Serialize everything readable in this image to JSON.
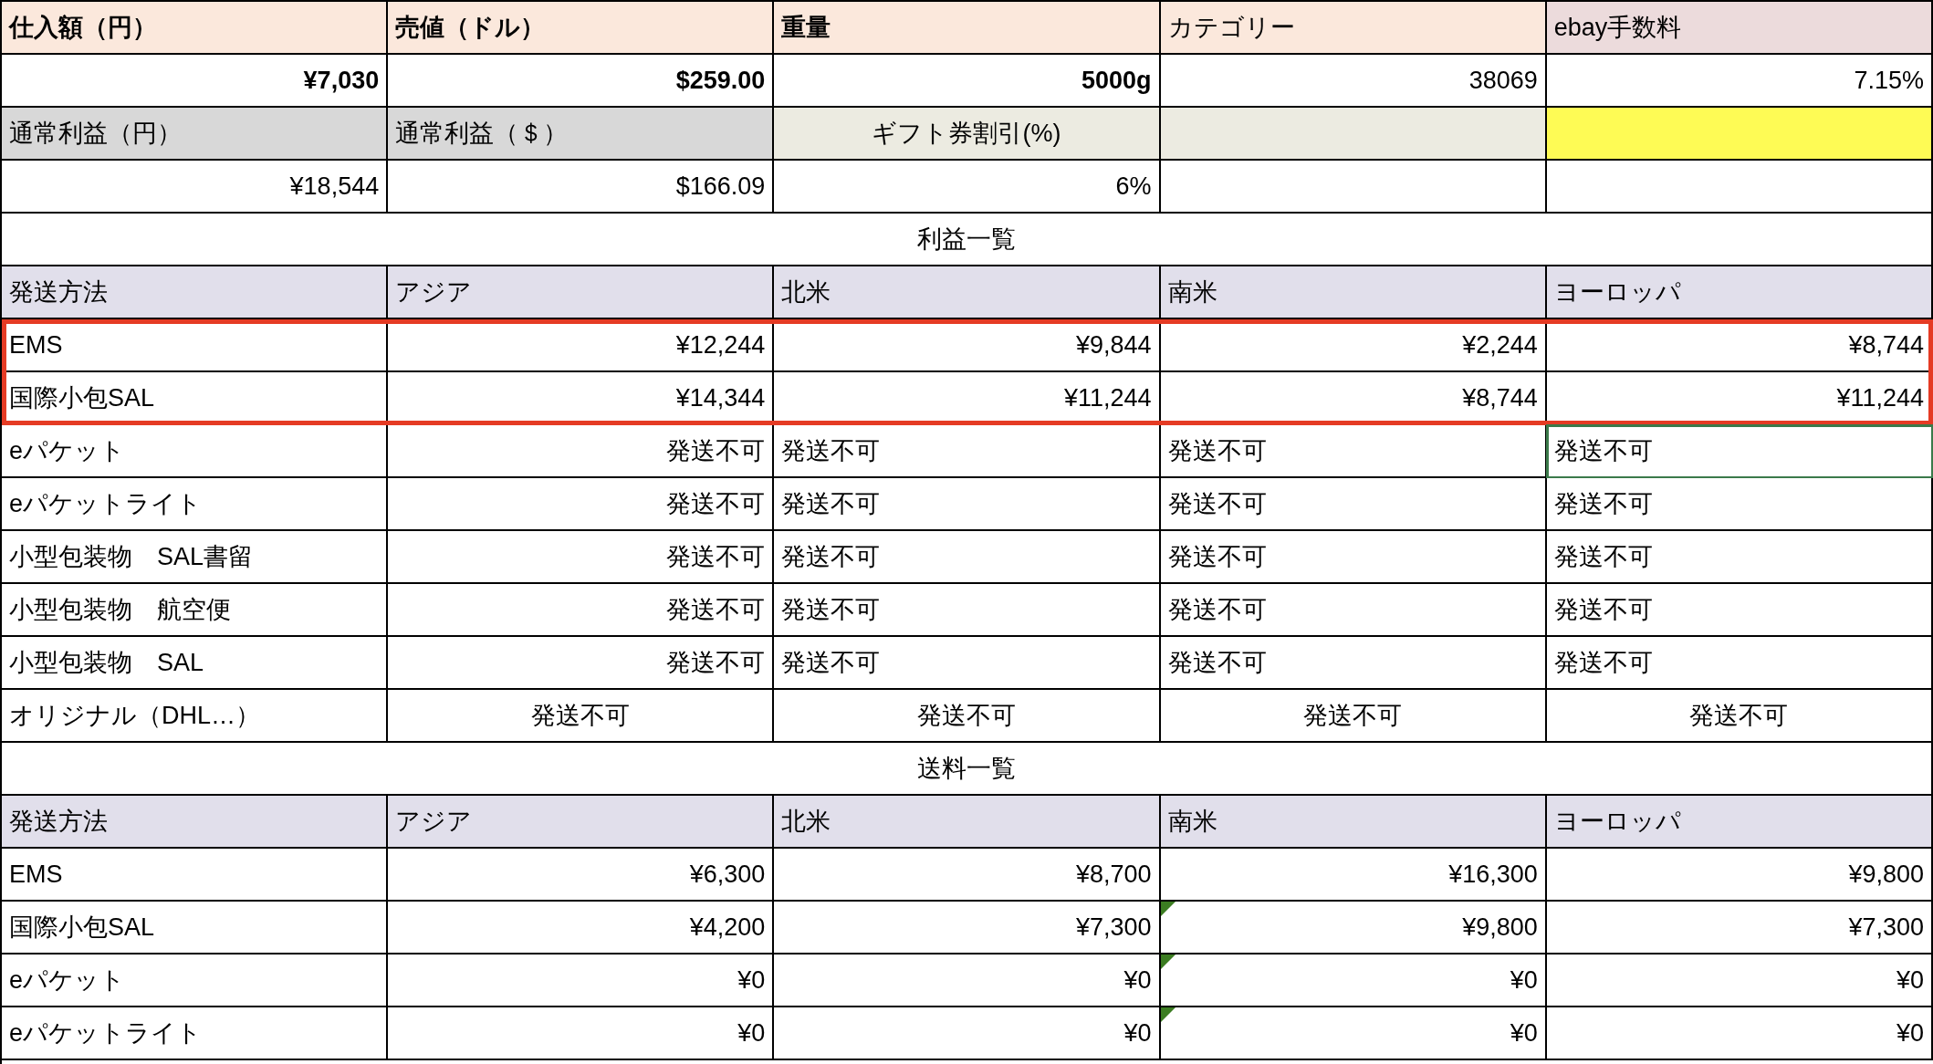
{
  "rows": [
    {
      "highlighted": false,
      "cells": [
        {
          "text": "仕入額（円）",
          "kind": "header-bold",
          "selected": false,
          "flagged": false
        },
        {
          "text": "売値（ドル）",
          "kind": "header-bold",
          "selected": false,
          "flagged": false
        },
        {
          "text": "重量",
          "kind": "header-bold",
          "selected": false,
          "flagged": false
        },
        {
          "text": "カテゴリー",
          "kind": "header",
          "selected": false,
          "flagged": false
        },
        {
          "text": "ebay手数料",
          "kind": "fee-header",
          "selected": false,
          "flagged": false
        }
      ]
    },
    {
      "highlighted": false,
      "cells": [
        {
          "text": "¥7,030",
          "kind": "bold-num",
          "selected": false,
          "flagged": false
        },
        {
          "text": "$259.00",
          "kind": "bold-num",
          "selected": false,
          "flagged": false
        },
        {
          "text": "5000g",
          "kind": "bold-num",
          "selected": false,
          "flagged": false
        },
        {
          "text": "38069",
          "kind": "num",
          "selected": false,
          "flagged": false
        },
        {
          "text": "7.15%",
          "kind": "num",
          "selected": false,
          "flagged": false
        }
      ]
    },
    {
      "highlighted": false,
      "cells": [
        {
          "text": "通常利益（円）",
          "kind": "gray",
          "selected": false,
          "flagged": false
        },
        {
          "text": "通常利益（＄）",
          "kind": "gray",
          "selected": false,
          "flagged": false
        },
        {
          "text": "ギフト券割引(%)",
          "kind": "beige-center",
          "selected": false,
          "flagged": false
        },
        {
          "kind": "beige",
          "selected": false,
          "flagged": false
        },
        {
          "kind": "yellow",
          "selected": false,
          "flagged": false
        }
      ]
    },
    {
      "highlighted": false,
      "cells": [
        {
          "text": "¥18,544",
          "kind": "num",
          "selected": false,
          "flagged": false
        },
        {
          "text": "$166.09",
          "kind": "num",
          "selected": false,
          "flagged": false
        },
        {
          "text": "6%",
          "kind": "num",
          "selected": false,
          "flagged": false
        },
        {
          "kind": "blank",
          "selected": false,
          "flagged": false
        },
        {
          "kind": "blank",
          "selected": false,
          "flagged": false
        }
      ]
    },
    {
      "highlighted": false,
      "cells": [
        {
          "text": "利益一覧",
          "kind": "title",
          "selected": false,
          "flagged": false
        }
      ]
    },
    {
      "highlighted": false,
      "cells": [
        {
          "text": "発送方法",
          "kind": "col-header",
          "selected": false,
          "flagged": false
        },
        {
          "text": "アジア",
          "kind": "col-header",
          "selected": false,
          "flagged": false
        },
        {
          "text": "北米",
          "kind": "col-header",
          "selected": false,
          "flagged": false
        },
        {
          "text": "南米",
          "kind": "col-header",
          "selected": false,
          "flagged": false
        },
        {
          "text": "ヨーロッパ",
          "kind": "col-header",
          "selected": false,
          "flagged": false
        }
      ]
    },
    {
      "highlighted": true,
      "cells": [
        {
          "text": "EMS",
          "kind": "text",
          "selected": false,
          "flagged": false
        },
        {
          "text": "¥12,244",
          "kind": "num",
          "selected": false,
          "flagged": false
        },
        {
          "text": "¥9,844",
          "kind": "num",
          "selected": false,
          "flagged": false
        },
        {
          "text": "¥2,244",
          "kind": "num",
          "selected": false,
          "flagged": false
        },
        {
          "text": "¥8,744",
          "kind": "num",
          "selected": false,
          "flagged": false
        }
      ]
    },
    {
      "highlighted": true,
      "cells": [
        {
          "text": "国際小包SAL",
          "kind": "text",
          "selected": false,
          "flagged": false
        },
        {
          "text": "¥14,344",
          "kind": "num",
          "selected": false,
          "flagged": false
        },
        {
          "text": "¥11,244",
          "kind": "num",
          "selected": false,
          "flagged": false
        },
        {
          "text": "¥8,744",
          "kind": "num",
          "selected": false,
          "flagged": false
        },
        {
          "text": "¥11,244",
          "kind": "num",
          "selected": false,
          "flagged": false
        }
      ]
    },
    {
      "highlighted": false,
      "cells": [
        {
          "text": "eパケット",
          "kind": "text",
          "selected": false,
          "flagged": false
        },
        {
          "text": "発送不可",
          "kind": "num",
          "selected": false,
          "flagged": false
        },
        {
          "text": "発送不可",
          "kind": "text",
          "selected": false,
          "flagged": false
        },
        {
          "text": "発送不可",
          "kind": "text",
          "selected": false,
          "flagged": false
        },
        {
          "text": "発送不可",
          "kind": "text",
          "selected": true,
          "flagged": false
        }
      ]
    },
    {
      "highlighted": false,
      "cells": [
        {
          "text": "eパケットライト",
          "kind": "text",
          "selected": false,
          "flagged": false
        },
        {
          "text": "発送不可",
          "kind": "num",
          "selected": false,
          "flagged": false
        },
        {
          "text": "発送不可",
          "kind": "text",
          "selected": false,
          "flagged": false
        },
        {
          "text": "発送不可",
          "kind": "text",
          "selected": false,
          "flagged": false
        },
        {
          "text": "発送不可",
          "kind": "text",
          "selected": false,
          "flagged": false
        }
      ]
    },
    {
      "highlighted": false,
      "cells": [
        {
          "text": "小型包装物　SAL書留",
          "kind": "text",
          "selected": false,
          "flagged": false
        },
        {
          "text": "発送不可",
          "kind": "num",
          "selected": false,
          "flagged": false
        },
        {
          "text": "発送不可",
          "kind": "text",
          "selected": false,
          "flagged": false
        },
        {
          "text": "発送不可",
          "kind": "text",
          "selected": false,
          "flagged": false
        },
        {
          "text": "発送不可",
          "kind": "text",
          "selected": false,
          "flagged": false
        }
      ]
    },
    {
      "highlighted": false,
      "cells": [
        {
          "text": "小型包装物　航空便",
          "kind": "text",
          "selected": false,
          "flagged": false
        },
        {
          "text": "発送不可",
          "kind": "num",
          "selected": false,
          "flagged": false
        },
        {
          "text": "発送不可",
          "kind": "text",
          "selected": false,
          "flagged": false
        },
        {
          "text": "発送不可",
          "kind": "text",
          "selected": false,
          "flagged": false
        },
        {
          "text": "発送不可",
          "kind": "text",
          "selected": false,
          "flagged": false
        }
      ]
    },
    {
      "highlighted": false,
      "cells": [
        {
          "text": "小型包装物　SAL",
          "kind": "text",
          "selected": false,
          "flagged": false
        },
        {
          "text": "発送不可",
          "kind": "num",
          "selected": false,
          "flagged": false
        },
        {
          "text": "発送不可",
          "kind": "text",
          "selected": false,
          "flagged": false
        },
        {
          "text": "発送不可",
          "kind": "text",
          "selected": false,
          "flagged": false
        },
        {
          "text": "発送不可",
          "kind": "text",
          "selected": false,
          "flagged": false
        }
      ]
    },
    {
      "highlighted": false,
      "cells": [
        {
          "text": "オリジナル（DHL…）",
          "kind": "text",
          "selected": false,
          "flagged": false
        },
        {
          "text": "発送不可",
          "kind": "center",
          "selected": false,
          "flagged": false
        },
        {
          "text": "発送不可",
          "kind": "center",
          "selected": false,
          "flagged": false
        },
        {
          "text": "発送不可",
          "kind": "center",
          "selected": false,
          "flagged": false
        },
        {
          "text": "発送不可",
          "kind": "center",
          "selected": false,
          "flagged": false
        }
      ]
    },
    {
      "highlighted": false,
      "cells": [
        {
          "text": "送料一覧",
          "kind": "title",
          "selected": false,
          "flagged": false
        }
      ]
    },
    {
      "highlighted": false,
      "cells": [
        {
          "text": "発送方法",
          "kind": "col-header",
          "selected": false,
          "flagged": false
        },
        {
          "text": "アジア",
          "kind": "col-header",
          "selected": false,
          "flagged": false
        },
        {
          "text": "北米",
          "kind": "col-header",
          "selected": false,
          "flagged": false
        },
        {
          "text": "南米",
          "kind": "col-header",
          "selected": false,
          "flagged": false
        },
        {
          "text": "ヨーロッパ",
          "kind": "col-header",
          "selected": false,
          "flagged": false
        }
      ]
    },
    {
      "highlighted": false,
      "cells": [
        {
          "text": "EMS",
          "kind": "text",
          "selected": false,
          "flagged": false
        },
        {
          "text": "¥6,300",
          "kind": "num",
          "selected": false,
          "flagged": false
        },
        {
          "text": "¥8,700",
          "kind": "num",
          "selected": false,
          "flagged": false
        },
        {
          "text": "¥16,300",
          "kind": "num",
          "selected": false,
          "flagged": false
        },
        {
          "text": "¥9,800",
          "kind": "num",
          "selected": false,
          "flagged": false
        }
      ]
    },
    {
      "highlighted": false,
      "cells": [
        {
          "text": "国際小包SAL",
          "kind": "text",
          "selected": false,
          "flagged": false
        },
        {
          "text": "¥4,200",
          "kind": "num",
          "selected": false,
          "flagged": false
        },
        {
          "text": "¥7,300",
          "kind": "num",
          "selected": false,
          "flagged": false
        },
        {
          "text": "¥9,800",
          "kind": "num",
          "selected": false,
          "flagged": true
        },
        {
          "text": "¥7,300",
          "kind": "num",
          "selected": false,
          "flagged": false
        }
      ]
    },
    {
      "highlighted": false,
      "cells": [
        {
          "text": "eパケット",
          "kind": "text",
          "selected": false,
          "flagged": false
        },
        {
          "text": "¥0",
          "kind": "num",
          "selected": false,
          "flagged": false
        },
        {
          "text": "¥0",
          "kind": "num",
          "selected": false,
          "flagged": false
        },
        {
          "text": "¥0",
          "kind": "num",
          "selected": false,
          "flagged": true
        },
        {
          "text": "¥0",
          "kind": "num",
          "selected": false,
          "flagged": false
        }
      ]
    },
    {
      "highlighted": false,
      "cells": [
        {
          "text": "eパケットライト",
          "kind": "text",
          "selected": false,
          "flagged": false
        },
        {
          "text": "¥0",
          "kind": "num",
          "selected": false,
          "flagged": false
        },
        {
          "text": "¥0",
          "kind": "num",
          "selected": false,
          "flagged": false
        },
        {
          "text": "¥0",
          "kind": "num",
          "selected": false,
          "flagged": true
        },
        {
          "text": "¥0",
          "kind": "num",
          "selected": false,
          "flagged": false
        }
      ]
    }
  ]
}
